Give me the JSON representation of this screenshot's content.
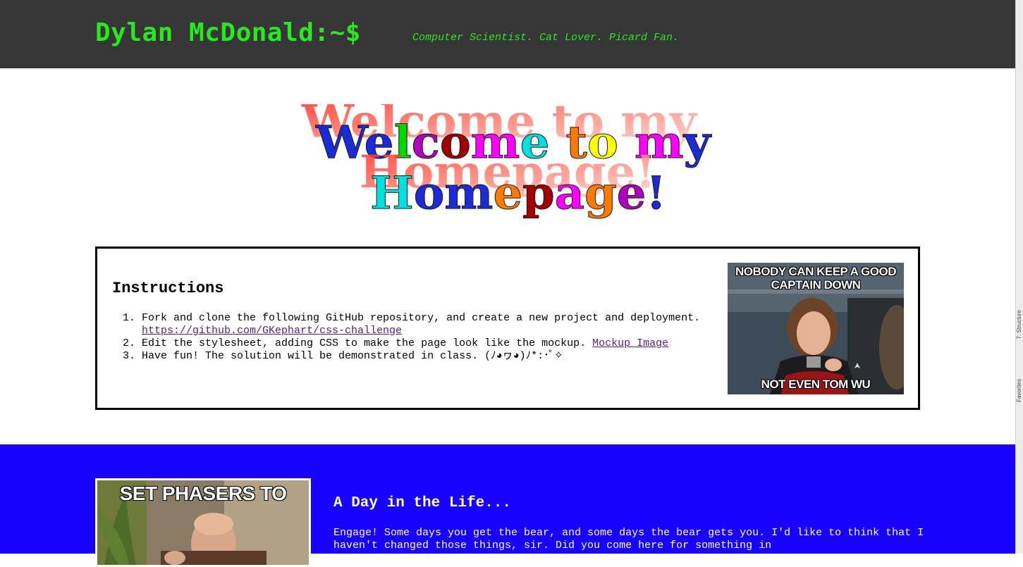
{
  "header": {
    "title": "Dylan McDonald:~$",
    "tagline": "Computer Scientist. Cat Lover. Picard Fan."
  },
  "welcome_banner": {
    "line1": "Welcome to my",
    "line2": "Homepage!"
  },
  "instructions": {
    "title": "Instructions",
    "items": [
      {
        "text": "Fork and clone the following GitHub repository, and create a new project and deployment.",
        "link": "https://github.com/GKephart/css-challenge"
      },
      {
        "text": "Edit the stylesheet, adding CSS to make the page look like the mockup.",
        "link": "Mockup Image"
      },
      {
        "text": "Have fun! The solution will be demonstrated in class. (ﾉ◕ヮ◕)ﾉ*:･ﾟ✧"
      }
    ],
    "meme": {
      "top": "NOBODY CAN KEEP A GOOD CAPTAIN DOWN",
      "bottom": "NOT EVEN TOM WU"
    }
  },
  "day_section": {
    "meme_top": "SET PHASERS TO",
    "title": "A Day in the Life...",
    "text": "Engage! Some days you get the bear, and some days the bear gets you. I'd like to think that I haven't changed those things, sir. Did you come here for something in"
  },
  "side_panel": {
    "structure": "7: Structure",
    "favorites": "Favorites"
  },
  "colors": {
    "header_bg": "#363636",
    "accent_green": "#27ea1d",
    "section_blue": "#1700fd"
  }
}
